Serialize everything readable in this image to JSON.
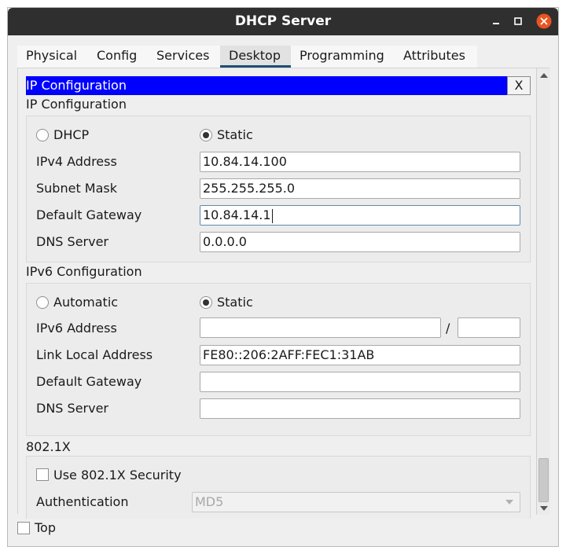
{
  "window": {
    "title": "DHCP Server"
  },
  "tabs": [
    {
      "label": "Physical"
    },
    {
      "label": "Config"
    },
    {
      "label": "Services"
    },
    {
      "label": "Desktop",
      "active": true
    },
    {
      "label": "Programming"
    },
    {
      "label": "Attributes"
    }
  ],
  "ip_config": {
    "header": "IP Configuration",
    "close_label": "X",
    "section_title": "IP Configuration",
    "mode_dhcp": "DHCP",
    "mode_static": "Static",
    "selected_mode": "Static",
    "ipv4_label": "IPv4 Address",
    "ipv4_value": "10.84.14.100",
    "subnet_label": "Subnet Mask",
    "subnet_value": "255.255.255.0",
    "gateway_label": "Default Gateway",
    "gateway_value": "10.84.14.1",
    "dns_label": "DNS Server",
    "dns_value": "0.0.0.0"
  },
  "ipv6_config": {
    "section_title": "IPv6 Configuration",
    "mode_auto": "Automatic",
    "mode_static": "Static",
    "selected_mode": "Static",
    "address_label": "IPv6 Address",
    "address_value": "",
    "prefix_sep": "/",
    "prefix_value": "",
    "link_local_label": "Link Local Address",
    "link_local_value": "FE80::206:2AFF:FEC1:31AB",
    "gateway_label": "Default Gateway",
    "gateway_value": "",
    "dns_label": "DNS Server",
    "dns_value": ""
  },
  "dot1x": {
    "section_title": "802.1X",
    "use_security_label": "Use 802.1X Security",
    "use_security_checked": false,
    "auth_label": "Authentication",
    "auth_value": "MD5"
  },
  "footer": {
    "top_label": "Top",
    "top_checked": false
  },
  "colors": {
    "titlebar": "#2f2f2f",
    "header_bar": "#0000ff",
    "close_button": "#e95420",
    "active_tab_underline": "#1e4e70"
  }
}
